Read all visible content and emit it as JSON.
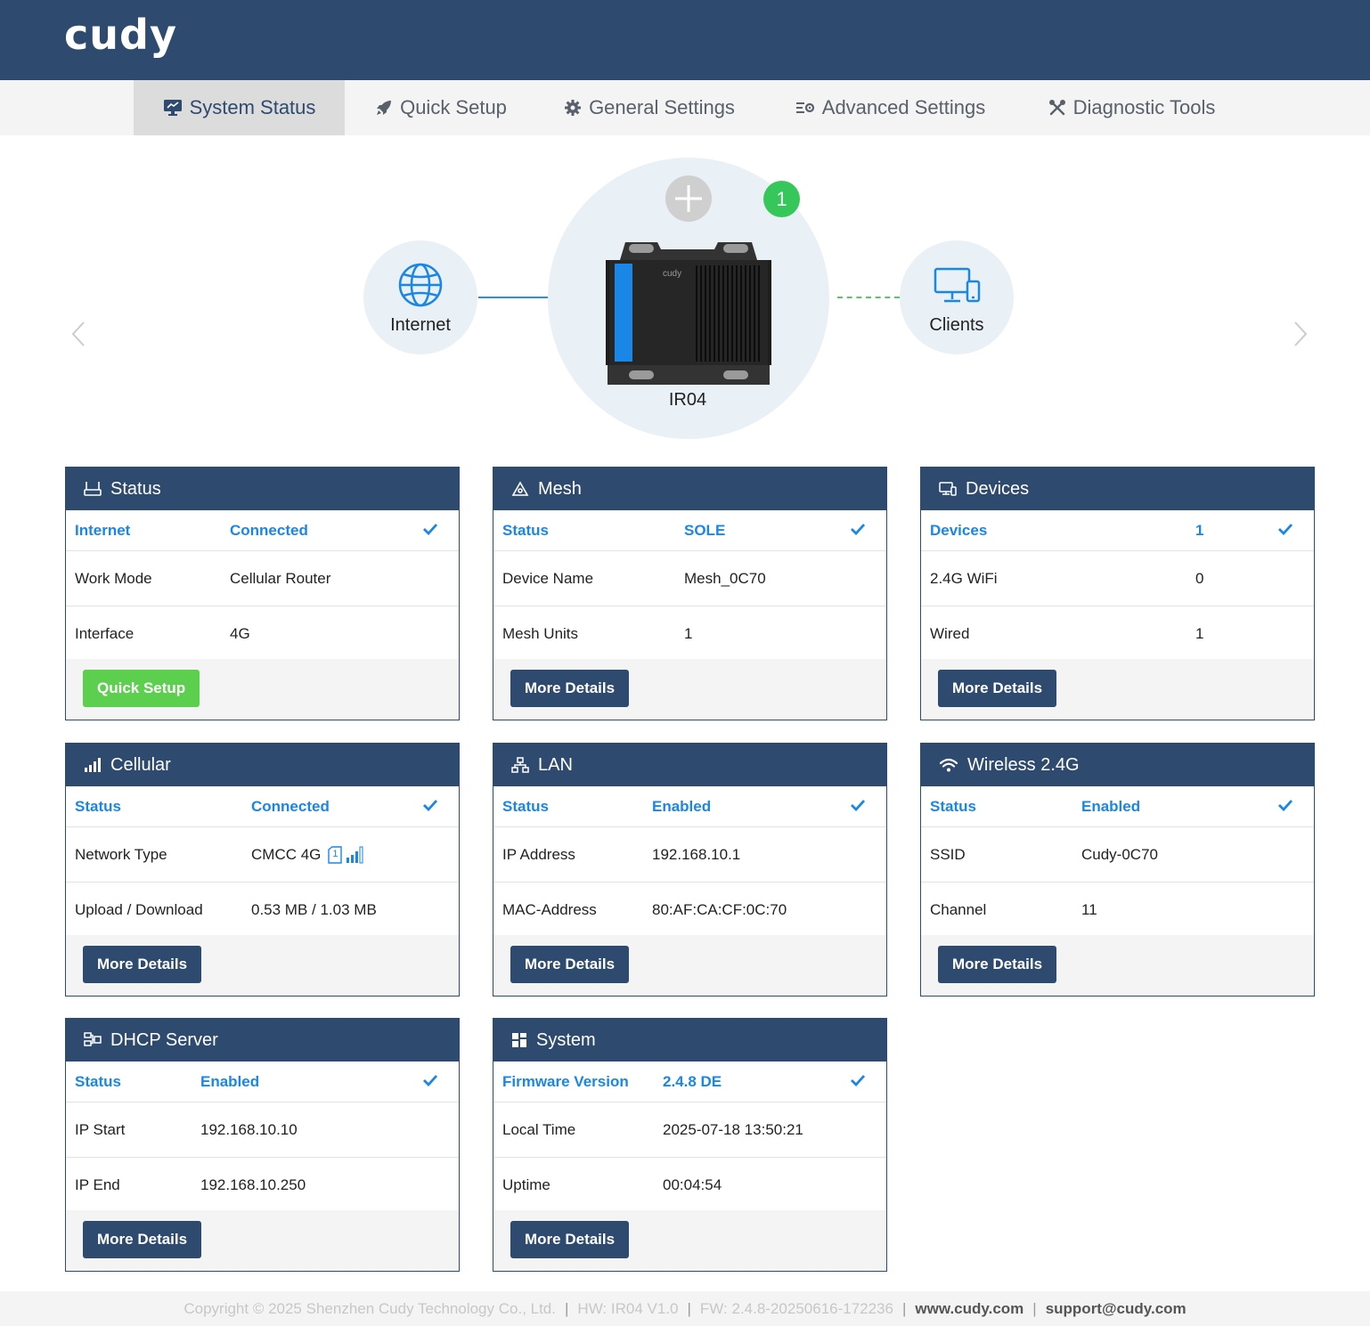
{
  "brand": {
    "logo": "cudy"
  },
  "nav": [
    {
      "label": "System Status",
      "icon": "monitor-icon",
      "active": true
    },
    {
      "label": "Quick Setup",
      "icon": "rocket-icon"
    },
    {
      "label": "General Settings",
      "icon": "gear-icon"
    },
    {
      "label": "Advanced Settings",
      "icon": "advanced-settings-icon"
    },
    {
      "label": "Diagnostic Tools",
      "icon": "tools-icon"
    }
  ],
  "topology": {
    "internet_label": "Internet",
    "clients_label": "Clients",
    "device_name": "IR04",
    "device_brand": "cudy",
    "client_count": "1",
    "colors": {
      "link": "#2b8fe6",
      "client_link": "#5cc46a",
      "badge": "#35c759"
    }
  },
  "cards": {
    "status": {
      "title": "Status",
      "rows": [
        {
          "key": "Internet",
          "value": "Connected"
        },
        {
          "key": "Work Mode",
          "value": "Cellular Router"
        },
        {
          "key": "Interface",
          "value": "4G"
        }
      ],
      "button": "Quick Setup"
    },
    "mesh": {
      "title": "Mesh",
      "rows": [
        {
          "key": "Status",
          "value": "SOLE"
        },
        {
          "key": "Device Name",
          "value": "Mesh_0C70"
        },
        {
          "key": "Mesh Units",
          "value": "1"
        }
      ],
      "button": "More Details"
    },
    "devices": {
      "title": "Devices",
      "rows": [
        {
          "key": "Devices",
          "value": "1"
        },
        {
          "key": "2.4G WiFi",
          "value": "0"
        },
        {
          "key": "Wired",
          "value": "1"
        }
      ],
      "button": "More Details"
    },
    "cellular": {
      "title": "Cellular",
      "rows": [
        {
          "key": "Status",
          "value": "Connected"
        },
        {
          "key": "Network Type",
          "value": "CMCC 4G"
        },
        {
          "key": "Upload / Download",
          "value": "0.53 MB / 1.03 MB"
        }
      ],
      "sim_slot": "1",
      "button": "More Details"
    },
    "lan": {
      "title": "LAN",
      "rows": [
        {
          "key": "Status",
          "value": "Enabled"
        },
        {
          "key": "IP Address",
          "value": "192.168.10.1"
        },
        {
          "key": "MAC-Address",
          "value": "80:AF:CA:CF:0C:70"
        }
      ],
      "button": "More Details"
    },
    "wireless": {
      "title": "Wireless 2.4G",
      "rows": [
        {
          "key": "Status",
          "value": "Enabled"
        },
        {
          "key": "SSID",
          "value": "Cudy-0C70"
        },
        {
          "key": "Channel",
          "value": "11"
        }
      ],
      "button": "More Details"
    },
    "dhcp": {
      "title": "DHCP Server",
      "rows": [
        {
          "key": "Status",
          "value": "Enabled"
        },
        {
          "key": "IP Start",
          "value": "192.168.10.10"
        },
        {
          "key": "IP End",
          "value": "192.168.10.250"
        }
      ],
      "button": "More Details"
    },
    "system": {
      "title": "System",
      "rows": [
        {
          "key": "Firmware Version",
          "value": "2.4.8 DE"
        },
        {
          "key": "Local Time",
          "value": "2025-07-18 13:50:21"
        },
        {
          "key": "Uptime",
          "value": "00:04:54"
        }
      ],
      "button": "More Details"
    }
  },
  "footer": {
    "copyright": "Copyright © 2025 Shenzhen Cudy Technology Co., Ltd.",
    "hw": "HW: IR04 V1.0",
    "fw": "FW: 2.4.8-20250616-172236",
    "website": "www.cudy.com",
    "email": "support@cudy.com",
    "separator": "|"
  },
  "colors": {
    "primary": "#2e4a6e",
    "accent": "#1a86e6",
    "green_button": "#5cd04e"
  }
}
